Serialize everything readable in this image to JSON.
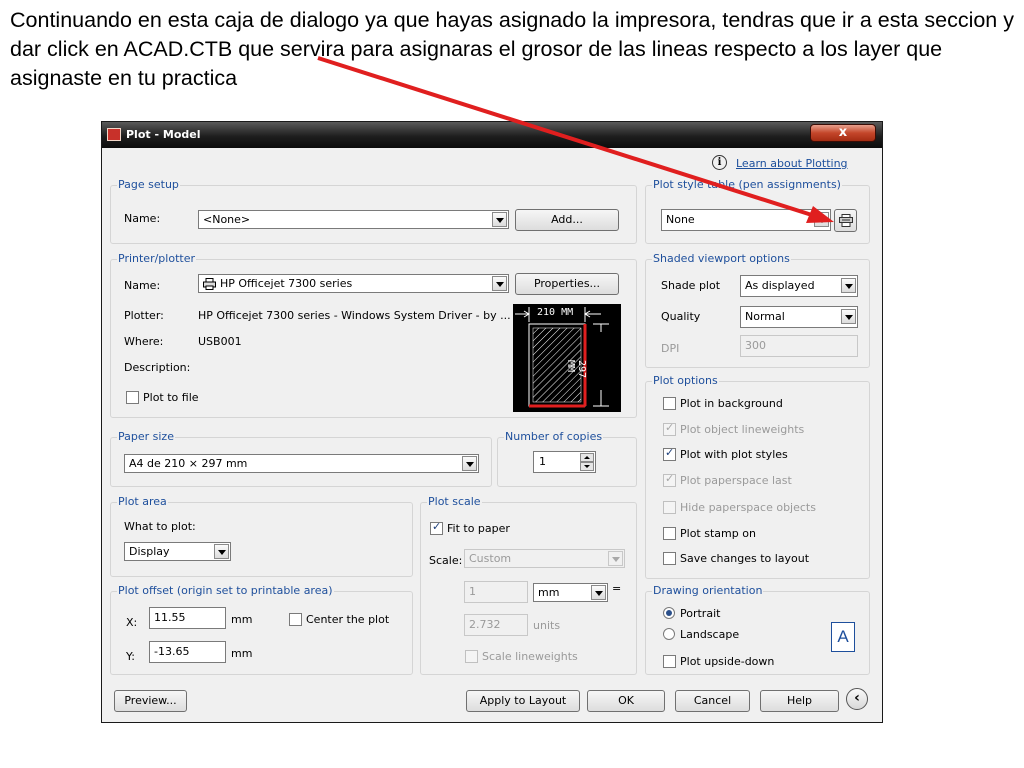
{
  "caption": "Continuando en esta caja de dialogo ya que hayas asignado la impresora, tendras que ir a esta seccion y dar click en  ACAD.CTB que servira para  asignaras el grosor de las lineas respecto a los layer que asignaste en tu practica",
  "dialog": {
    "title": "Plot - Model",
    "close_label": "x",
    "learn_link": "Learn about Plotting"
  },
  "page_setup": {
    "legend": "Page setup",
    "name_label": "Name:",
    "name_value": "<None>",
    "add_label": "Add..."
  },
  "printer": {
    "legend": "Printer/plotter",
    "name_label": "Name:",
    "name_value": "HP Officejet 7300 series",
    "properties_label": "Properties...",
    "plotter_label": "Plotter:",
    "plotter_value": "HP Officejet 7300 series - Windows System Driver - by ...",
    "where_label": "Where:",
    "where_value": "USB001",
    "description_label": "Description:",
    "plot_to_file_label": "Plot to file",
    "plot_to_file_checked": false,
    "preview": {
      "width_text": "210 MM",
      "height_text": "297 MM"
    }
  },
  "paper_size": {
    "legend": "Paper size",
    "value": "A4 de 210 × 297 mm"
  },
  "copies": {
    "legend": "Number of copies",
    "value": "1"
  },
  "plot_area": {
    "legend": "Plot area",
    "what_label": "What to plot:",
    "what_value": "Display"
  },
  "plot_offset": {
    "legend": "Plot offset (origin set to printable area)",
    "x_label": "X:",
    "x_value": "11.55",
    "x_unit": "mm",
    "y_label": "Y:",
    "y_value": "-13.65",
    "y_unit": "mm",
    "center_label": "Center the plot"
  },
  "plot_scale": {
    "legend": "Plot scale",
    "fit_label": "Fit to paper",
    "scale_label": "Scale:",
    "scale_value": "Custom",
    "value1": "1",
    "unit1": "mm",
    "equals": "=",
    "value2": "2.732",
    "unit2": "units",
    "scale_lw_label": "Scale lineweights"
  },
  "plot_style_table": {
    "legend": "Plot style table (pen assignments)",
    "value": "None"
  },
  "shaded": {
    "legend": "Shaded viewport options",
    "shade_label": "Shade plot",
    "shade_value": "As displayed",
    "quality_label": "Quality",
    "quality_value": "Normal",
    "dpi_label": "DPI",
    "dpi_value": "300"
  },
  "plot_options": {
    "legend": "Plot options",
    "items": [
      {
        "label": "Plot in background",
        "checked": false,
        "enabled": true
      },
      {
        "label": "Plot object lineweights",
        "checked": true,
        "enabled": false
      },
      {
        "label": "Plot with plot styles",
        "checked": true,
        "enabled": true
      },
      {
        "label": "Plot paperspace last",
        "checked": true,
        "enabled": false
      },
      {
        "label": "Hide paperspace objects",
        "checked": false,
        "enabled": false
      },
      {
        "label": "Plot stamp on",
        "checked": false,
        "enabled": true
      },
      {
        "label": "Save changes to layout",
        "checked": false,
        "enabled": true
      }
    ]
  },
  "orientation": {
    "legend": "Drawing orientation",
    "portrait_label": "Portrait",
    "landscape_label": "Landscape",
    "upside_label": "Plot upside-down",
    "icon_letter": "A"
  },
  "footer": {
    "preview": "Preview...",
    "apply": "Apply to Layout",
    "ok": "OK",
    "cancel": "Cancel",
    "help": "Help"
  },
  "colors": {
    "annotation_arrow": "#e01f1f",
    "legend_text": "#1e4f9c"
  }
}
